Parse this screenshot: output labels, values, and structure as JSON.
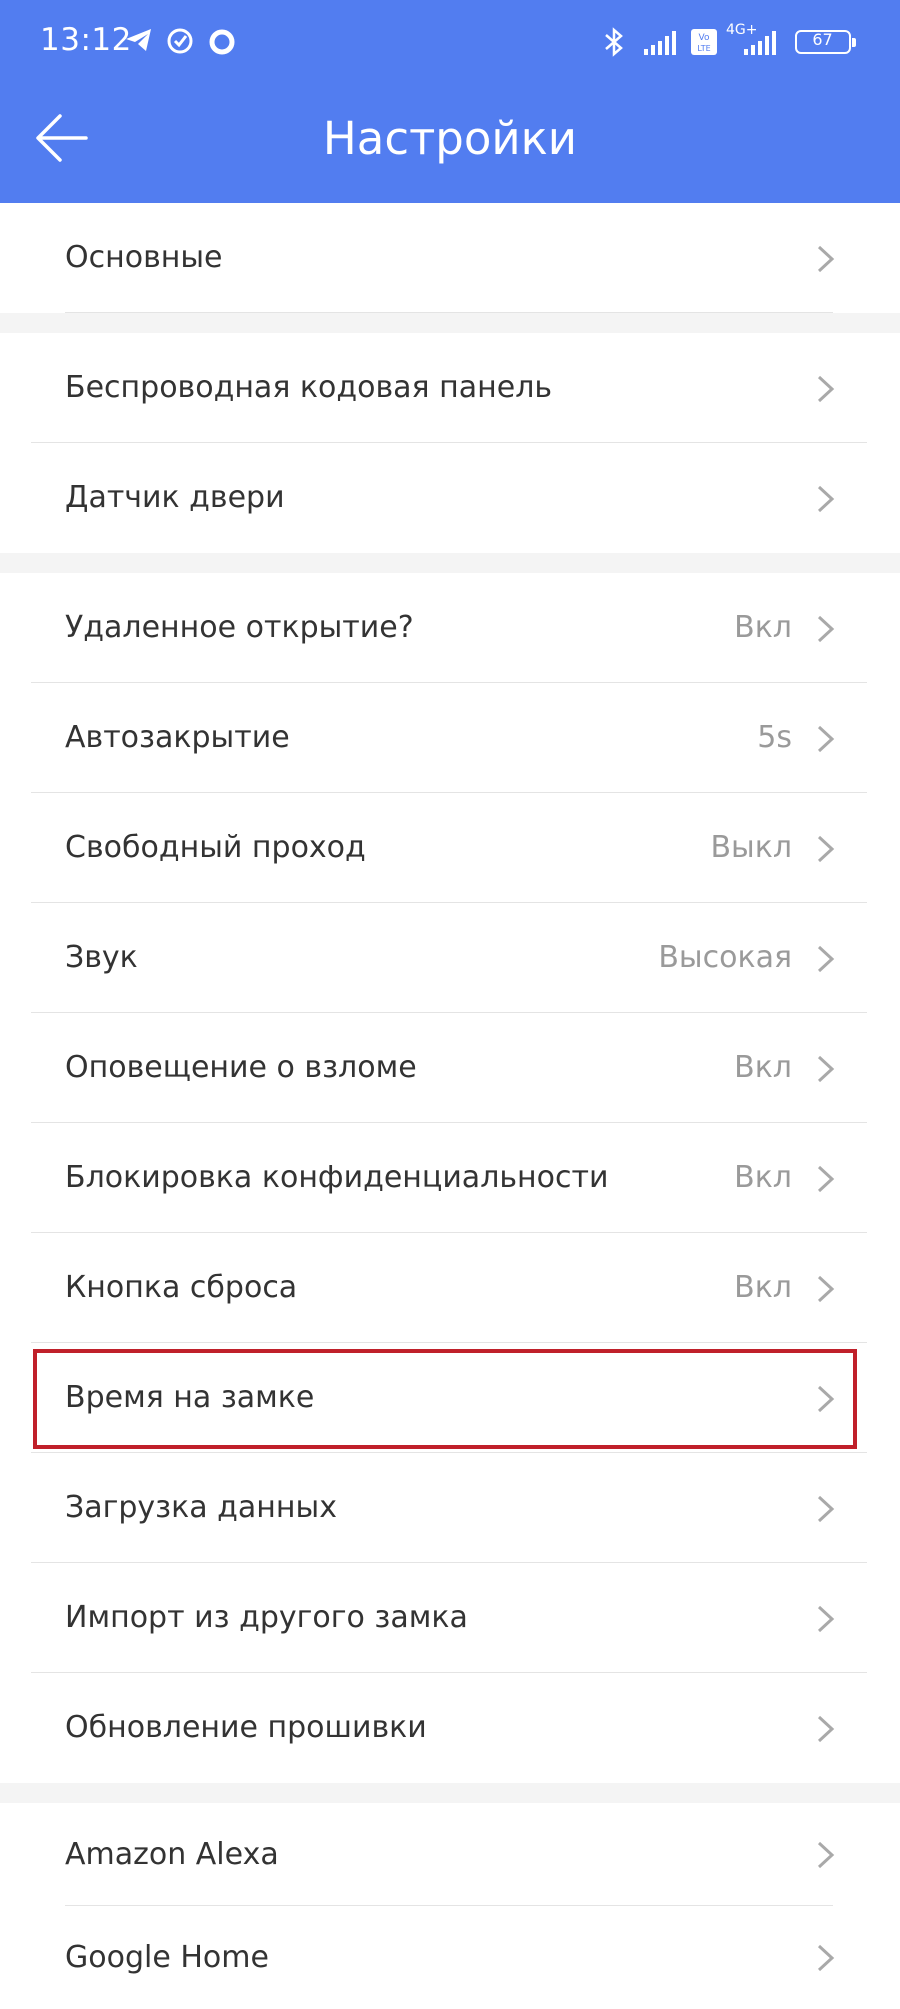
{
  "status_bar": {
    "time": "13:12",
    "battery": "67",
    "network": "4G+"
  },
  "header": {
    "title": "Настройки",
    "back_icon": "arrow-left-icon"
  },
  "settings": [
    {
      "label": "Основные",
      "value": ""
    },
    {
      "label": "Беспроводная кодовая панель",
      "value": ""
    },
    {
      "label": "Датчик двери",
      "value": ""
    },
    {
      "label": "Удаленное открытие?",
      "value": "Вкл"
    },
    {
      "label": "Автозакрытие",
      "value": "5s"
    },
    {
      "label": "Свободный проход",
      "value": "Выкл"
    },
    {
      "label": "Звук",
      "value": "Высокая"
    },
    {
      "label": "Оповещение о взломе",
      "value": "Вкл"
    },
    {
      "label": "Блокировка конфиденциальности",
      "value": "Вкл"
    },
    {
      "label": "Кнопка сброса",
      "value": "Вкл"
    },
    {
      "label": "Время на замке",
      "value": ""
    },
    {
      "label": "Загрузка данных",
      "value": ""
    },
    {
      "label": "Импорт из другого замка",
      "value": ""
    },
    {
      "label": "Обновление прошивки",
      "value": ""
    },
    {
      "label": "Amazon Alexa",
      "value": ""
    },
    {
      "label": "Google Home",
      "value": ""
    }
  ],
  "colors": {
    "header": "#527df0",
    "highlight_border": "#c0202a",
    "value_text": "#9a9a9a"
  }
}
